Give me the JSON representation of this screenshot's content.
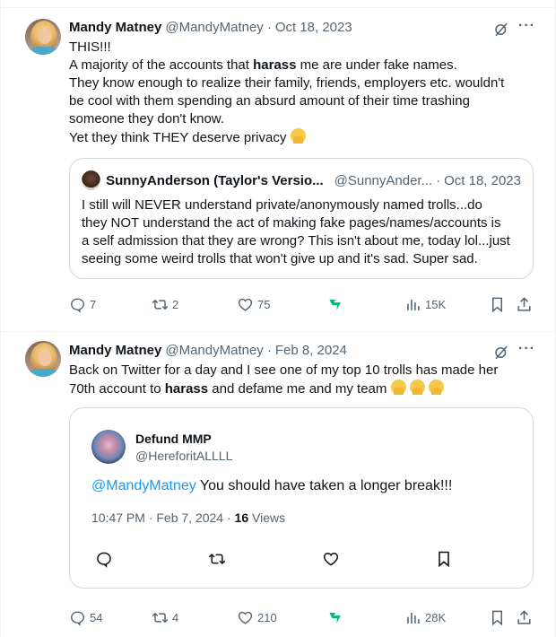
{
  "tweets": [
    {
      "name": "Mandy Matney",
      "handle": "@MandyMatney",
      "dot": "·",
      "date": "Oct 18, 2023",
      "lines": [
        "THIS!!!",
        [
          "A majority of the accounts that ",
          "harass",
          " me are under fake names."
        ],
        "They know enough to realize their family, friends, employers etc. wouldn't",
        "be cool with them spending an absurd amount of their time trashing",
        "someone they don't know.",
        "Yet they think THEY deserve privacy"
      ],
      "quote": {
        "name": "SunnyAnderson (Taylor's Versio...",
        "handle": "@SunnyAnder...",
        "dot": "·",
        "date": "Oct 18, 2023",
        "lines": [
          "I still will NEVER understand private/anonymously named trolls...do",
          "they NOT understand the act of making fake pages/names/accounts is",
          "a self admission that they are wrong? This isn't about me, today lol...just",
          "seeing some weird trolls that won't give up and it's sad. Super sad."
        ]
      },
      "stats": {
        "replies": "7",
        "retweets": "2",
        "likes": "75",
        "views": "15K"
      }
    },
    {
      "name": "Mandy Matney",
      "handle": "@MandyMatney",
      "dot": "·",
      "date": "Feb 8, 2024",
      "line1": "Back on Twitter for a day and I see one of my top 10 trolls has made her",
      "line2_pre": "70th account to ",
      "line2_bold": "harass",
      "line2_post": " and defame me and my team",
      "embed": {
        "name": "Defund MMP",
        "handle": "@HereforitALLLL",
        "mention": "@MandyMatney",
        "text": " You should have taken a longer break!!!",
        "time": "10:47 PM · Feb 7, 2024 · ",
        "views_count": "16",
        "views_label": " Views"
      },
      "stats": {
        "replies": "54",
        "retweets": "4",
        "likes": "210",
        "views": "28K"
      }
    }
  ],
  "icons": {
    "reply": "reply-icon",
    "retweet": "retweet-icon",
    "like": "heart-icon",
    "grok_brand": "grok-icon",
    "views": "analytics-icon",
    "bookmark": "bookmark-icon",
    "share": "share-icon",
    "more": "more-icon",
    "grok_header": "grok-slash-icon"
  },
  "colors": {
    "accent": "#1d9bf0",
    "grok_brand": "#00ba7c",
    "muted": "#536471",
    "border": "#cfd9de"
  }
}
